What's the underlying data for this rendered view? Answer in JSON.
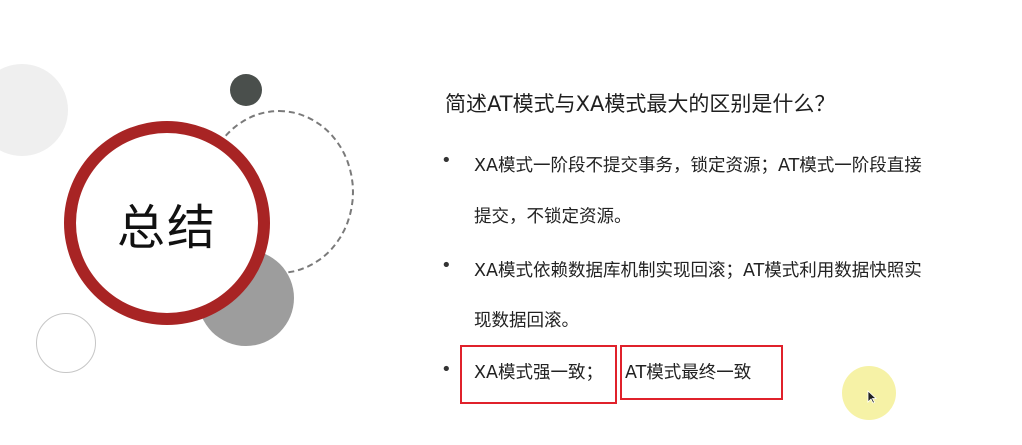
{
  "slide": {
    "badge": "总结",
    "question": "简述AT模式与XA模式最大的区别是什么？",
    "bullets": [
      {
        "lines": [
          "XA模式一阶段不提交事务，锁定资源；AT模式一阶段直接",
          "提交，不锁定资源。"
        ]
      },
      {
        "lines": [
          "XA模式依赖数据库机制实现回滚；AT模式利用数据快照实",
          "现数据回滚。"
        ]
      },
      {
        "parts": [
          "XA模式强一致；",
          "AT模式最终一致"
        ]
      }
    ],
    "bullet_symbol": "•",
    "colors": {
      "accent_red": "#a82424",
      "highlight_box": "#e0212b"
    }
  }
}
